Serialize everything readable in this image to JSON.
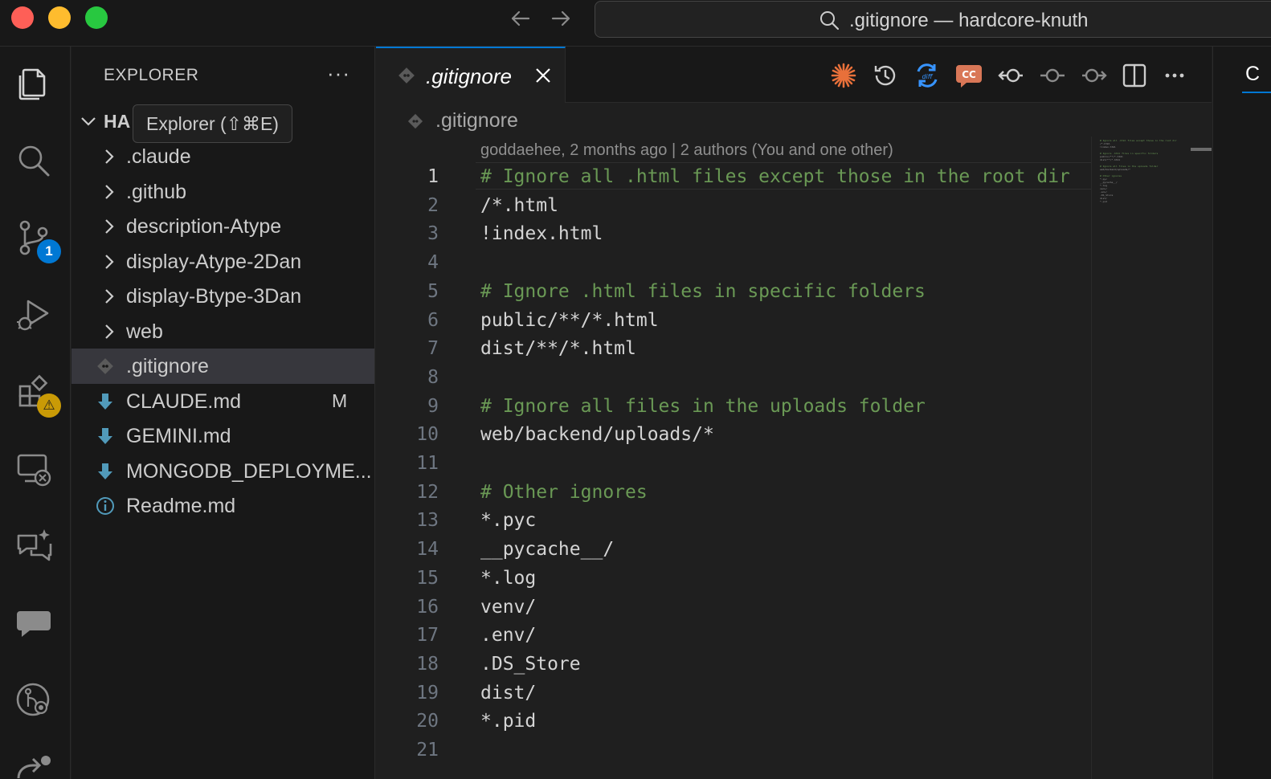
{
  "window": {
    "title": ".gitignore — hardcore-knuth"
  },
  "activity_bar": {
    "source_control_badge": "1"
  },
  "sidebar": {
    "header": "EXPLORER",
    "more_label": "···",
    "root_folder": "HA",
    "tooltip": "Explorer (⇧⌘E)",
    "items": [
      {
        "label": ".claude",
        "kind": "folder",
        "icon": "chevron-right-icon"
      },
      {
        "label": ".github",
        "kind": "folder",
        "icon": "chevron-right-icon"
      },
      {
        "label": "description-Atype",
        "kind": "folder",
        "icon": "chevron-right-icon"
      },
      {
        "label": "display-Atype-2Dan",
        "kind": "folder",
        "icon": "chevron-right-icon"
      },
      {
        "label": "display-Btype-3Dan",
        "kind": "folder",
        "icon": "chevron-right-icon"
      },
      {
        "label": "web",
        "kind": "folder",
        "icon": "chevron-right-icon"
      },
      {
        "label": ".gitignore",
        "kind": "file",
        "icon": "git-file-icon",
        "selected": true
      },
      {
        "label": "CLAUDE.md",
        "kind": "file",
        "icon": "markdown-download-icon",
        "status": "M"
      },
      {
        "label": "GEMINI.md",
        "kind": "file",
        "icon": "markdown-download-icon"
      },
      {
        "label": "MONGODB_DEPLOYME...",
        "kind": "file",
        "icon": "markdown-download-icon"
      },
      {
        "label": "Readme.md",
        "kind": "file",
        "icon": "info-icon"
      }
    ]
  },
  "editor": {
    "tab_label": ".gitignore",
    "breadcrumb": ".gitignore",
    "blame": "goddaehee, 2 months ago | 2 authors (You and one other)",
    "active_line": 1,
    "lines": [
      {
        "n": "1",
        "text": "# Ignore all .html files except those in the root dir",
        "comment": true
      },
      {
        "n": "2",
        "text": "/*.html",
        "comment": false
      },
      {
        "n": "3",
        "text": "!index.html",
        "comment": false
      },
      {
        "n": "4",
        "text": "",
        "comment": false
      },
      {
        "n": "5",
        "text": "# Ignore .html files in specific folders",
        "comment": true
      },
      {
        "n": "6",
        "text": "public/**/*.html",
        "comment": false
      },
      {
        "n": "7",
        "text": "dist/**/*.html",
        "comment": false
      },
      {
        "n": "8",
        "text": "",
        "comment": false
      },
      {
        "n": "9",
        "text": "# Ignore all files in the uploads folder",
        "comment": true
      },
      {
        "n": "10",
        "text": "web/backend/uploads/*",
        "comment": false
      },
      {
        "n": "11",
        "text": "",
        "comment": false
      },
      {
        "n": "12",
        "text": "# Other ignores",
        "comment": true
      },
      {
        "n": "13",
        "text": "*.pyc",
        "comment": false
      },
      {
        "n": "14",
        "text": "__pycache__/",
        "comment": false
      },
      {
        "n": "15",
        "text": "*.log",
        "comment": false
      },
      {
        "n": "16",
        "text": "venv/",
        "comment": false
      },
      {
        "n": "17",
        "text": ".env/",
        "comment": false
      },
      {
        "n": "18",
        "text": ".DS_Store",
        "comment": false
      },
      {
        "n": "19",
        "text": "dist/",
        "comment": false
      },
      {
        "n": "20",
        "text": "*.pid",
        "comment": false
      },
      {
        "n": "21",
        "text": "",
        "comment": false
      }
    ]
  },
  "right_panel": {
    "tab_label": "C"
  },
  "colors": {
    "accent": "#0078d4",
    "comment": "#6a9955",
    "claude_orange": "#e8703a",
    "warning": "#c99a06"
  }
}
